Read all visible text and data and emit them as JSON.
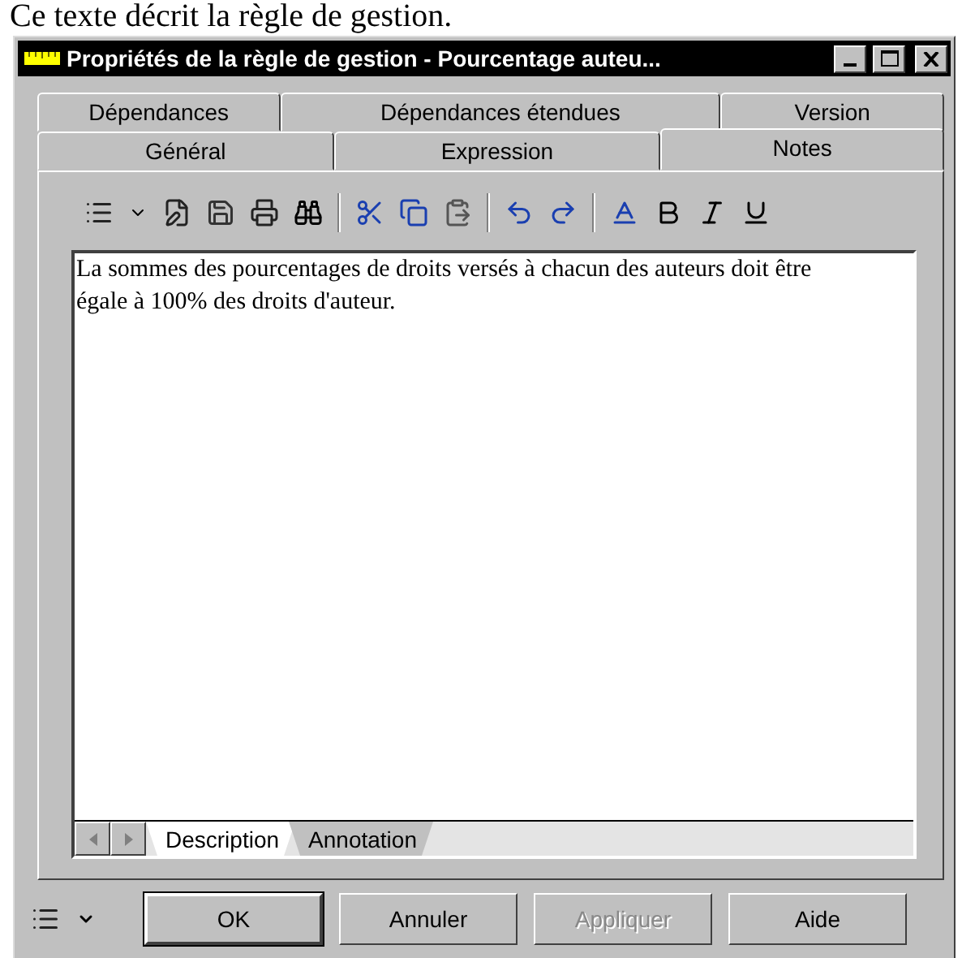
{
  "caption": "Ce texte décrit la règle de gestion.",
  "window": {
    "title": "Propriétés de la règle de gestion - Pourcentage auteu..."
  },
  "tab_rows": [
    [
      {
        "label": "Dépendances",
        "selected": false
      },
      {
        "label": "Dépendances étendues",
        "selected": false
      },
      {
        "label": "Version",
        "selected": false
      }
    ],
    [
      {
        "label": "Général",
        "selected": false
      },
      {
        "label": "Expression",
        "selected": false
      },
      {
        "label": "Notes",
        "selected": true
      }
    ]
  ],
  "editor": {
    "value": "La sommes des pourcentages de droits versés à chacun des auteurs doit être égale à 100% des droits d'auteur."
  },
  "sheet_tabs": [
    {
      "label": "Description",
      "selected": true
    },
    {
      "label": "Annotation",
      "selected": false
    }
  ],
  "buttons": [
    {
      "label": "OK",
      "default": true,
      "disabled": false
    },
    {
      "label": "Annuler",
      "default": false,
      "disabled": false
    },
    {
      "label": "Appliquer",
      "default": false,
      "disabled": true
    },
    {
      "label": "Aide",
      "default": false,
      "disabled": false
    }
  ]
}
